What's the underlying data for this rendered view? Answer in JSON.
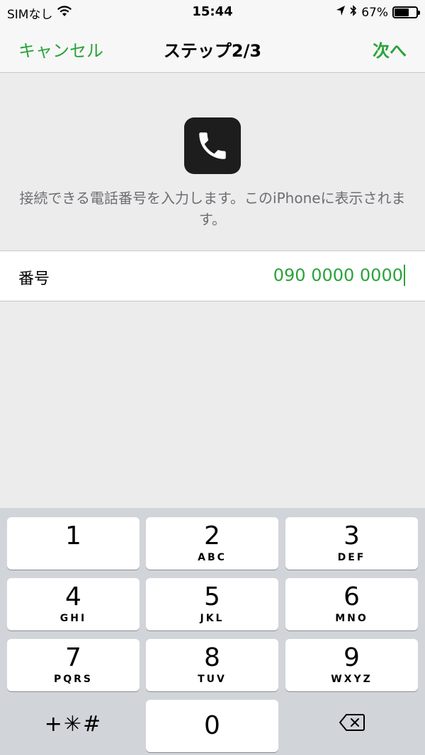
{
  "status": {
    "carrier": "SIMなし",
    "time": "15:44",
    "battery_percent": "67%",
    "battery_level": 0.67
  },
  "nav": {
    "cancel_label": "キャンセル",
    "title": "ステップ2/3",
    "next_label": "次へ"
  },
  "header": {
    "icon": "phone-icon",
    "description": "接続できる電話番号を入力します。このiPhoneに表示されます。"
  },
  "input": {
    "label": "番号",
    "value": "090 0000 0000"
  },
  "keypad": {
    "keys": [
      {
        "digit": "1",
        "letters": ""
      },
      {
        "digit": "2",
        "letters": "ABC"
      },
      {
        "digit": "3",
        "letters": "DEF"
      },
      {
        "digit": "4",
        "letters": "GHI"
      },
      {
        "digit": "5",
        "letters": "JKL"
      },
      {
        "digit": "6",
        "letters": "MNO"
      },
      {
        "digit": "7",
        "letters": "PQRS"
      },
      {
        "digit": "8",
        "letters": "TUV"
      },
      {
        "digit": "9",
        "letters": "WXYZ"
      },
      {
        "digit": "0",
        "letters": ""
      }
    ],
    "symbols_label": "+✳#",
    "delete_icon": "backspace-icon"
  },
  "colors": {
    "accent": "#29a339",
    "background": "#ececed",
    "keypad_bg": "#d1d4d9"
  }
}
